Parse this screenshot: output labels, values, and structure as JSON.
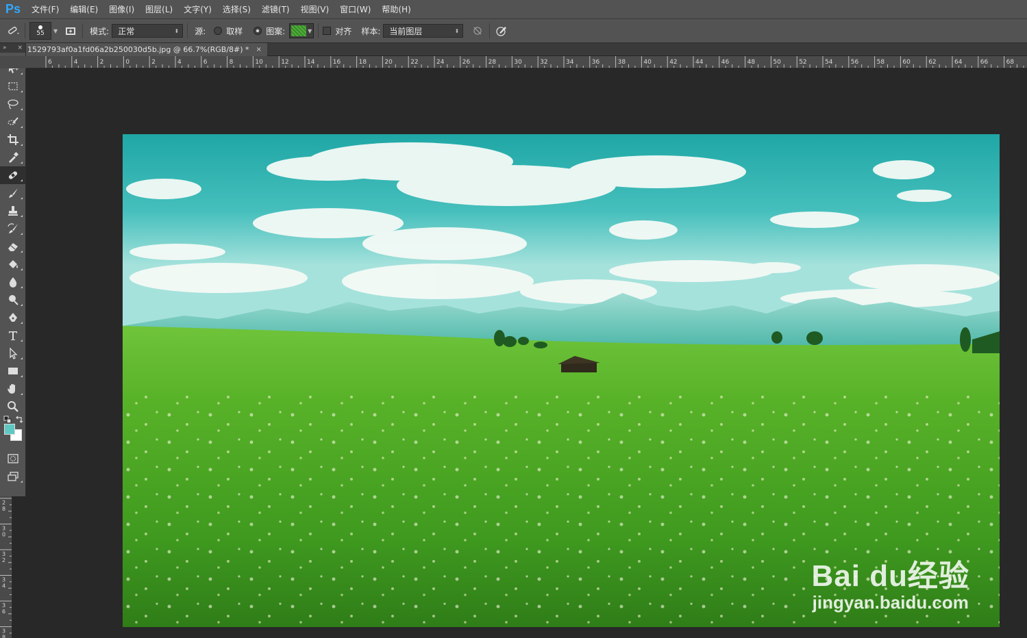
{
  "app": {
    "logo": "Ps"
  },
  "menu": [
    "文件(F)",
    "编辑(E)",
    "图像(I)",
    "图层(L)",
    "文字(Y)",
    "选择(S)",
    "滤镜(T)",
    "视图(V)",
    "窗口(W)",
    "帮助(H)"
  ],
  "options": {
    "brush_size": "55",
    "mode_label": "模式:",
    "mode_value": "正常",
    "source_label": "源:",
    "sampled_label": "取样",
    "pattern_label": "图案:",
    "aligned_label": "对齐",
    "sample_label": "样本:",
    "sample_value": "当前图层"
  },
  "document": {
    "tab_title": "1529793af0a1fd06a2b250030d5b.jpg @ 66.7%(RGB/8#) *",
    "close": "×"
  },
  "ruler_h_labels": [
    "6",
    "4",
    "2",
    "0",
    "2",
    "4",
    "6",
    "8",
    "10",
    "12",
    "14",
    "16",
    "18",
    "20",
    "22",
    "24",
    "26",
    "28",
    "30",
    "32",
    "34",
    "36",
    "38",
    "40",
    "42",
    "44",
    "46",
    "48",
    "50",
    "52",
    "54",
    "56",
    "58",
    "60",
    "62",
    "64",
    "66",
    "68"
  ],
  "ruler_v_labels": [
    "28",
    "30",
    "32",
    "34",
    "36",
    "38"
  ],
  "colors": {
    "foreground": "#5fc8c2",
    "background": "#ffffff"
  },
  "watermark": {
    "logo": "Bai du经验",
    "url": "jingyan.baidu.com"
  },
  "tools": [
    {
      "name": "move-tool-icon"
    },
    {
      "name": "marquee-tool-icon"
    },
    {
      "name": "lasso-tool-icon"
    },
    {
      "name": "quick-selection-tool-icon"
    },
    {
      "name": "crop-tool-icon"
    },
    {
      "name": "eyedropper-tool-icon"
    },
    {
      "name": "healing-brush-tool-icon"
    },
    {
      "name": "brush-tool-icon"
    },
    {
      "name": "clone-stamp-tool-icon"
    },
    {
      "name": "history-brush-tool-icon"
    },
    {
      "name": "eraser-tool-icon"
    },
    {
      "name": "paint-bucket-tool-icon"
    },
    {
      "name": "blur-tool-icon"
    },
    {
      "name": "dodge-tool-icon"
    },
    {
      "name": "pen-tool-icon"
    },
    {
      "name": "type-tool-icon"
    },
    {
      "name": "path-selection-tool-icon"
    },
    {
      "name": "rectangle-tool-icon"
    },
    {
      "name": "hand-tool-icon"
    },
    {
      "name": "zoom-tool-icon"
    }
  ]
}
